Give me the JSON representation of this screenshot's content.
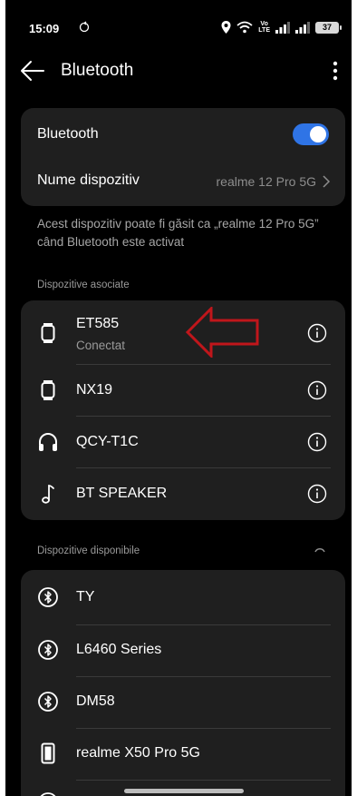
{
  "status_bar": {
    "time": "15:09",
    "volte_line1": "Vo",
    "volte_line2": "LTE",
    "battery": "37"
  },
  "header": {
    "title": "Bluetooth"
  },
  "settings": {
    "bluetooth_label": "Bluetooth",
    "bluetooth_on": true,
    "device_name_label": "Nume dispozitiv",
    "device_name_value": "realme 12 Pro 5G"
  },
  "description": "Acest dispozitiv poate fi găsit ca „realme 12 Pro 5G” când Bluetooth este activat",
  "paired": {
    "label": "Dispozitive asociate",
    "devices": [
      {
        "name": "ET585",
        "status": "Conectat",
        "icon": "watch-icon"
      },
      {
        "name": "NX19",
        "status": "",
        "icon": "watch-icon"
      },
      {
        "name": "QCY-T1C",
        "status": "",
        "icon": "headphones-icon"
      },
      {
        "name": "BT SPEAKER",
        "status": "",
        "icon": "music-note-icon"
      }
    ]
  },
  "available": {
    "label": "Dispozitive disponibile",
    "devices": [
      {
        "name": "TY",
        "icon": "bluetooth-icon"
      },
      {
        "name": "L6460 Series",
        "icon": "bluetooth-icon"
      },
      {
        "name": "DM58",
        "icon": "bluetooth-icon"
      },
      {
        "name": "realme X50 Pro 5G",
        "icon": "phone-icon"
      }
    ]
  },
  "colors": {
    "background": "#000000",
    "card": "#1f1f1f",
    "accent": "#2f74e6",
    "annotation_arrow": "#c0161b"
  }
}
